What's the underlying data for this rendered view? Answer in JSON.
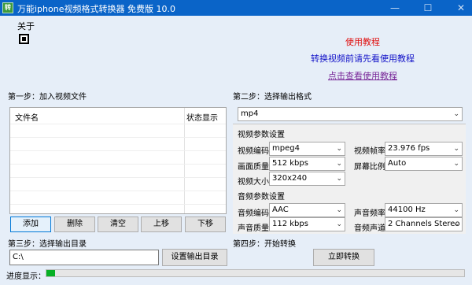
{
  "window": {
    "title": "万能iphone视频格式转换器 免费版 10.0",
    "minimize": "—",
    "maximize": "☐",
    "close": "✕"
  },
  "menu": {
    "about": "关于"
  },
  "help": {
    "tutorial_link": "使用教程",
    "notice": "转换视频前请先看使用教程",
    "view_tutorial_link": "点击查看使用教程"
  },
  "step1": {
    "label": "第一步：加入视频文件",
    "columns": [
      "文件名",
      "状态显示"
    ],
    "buttons": {
      "add": "添加",
      "delete": "删除",
      "clear": "清空",
      "up": "上移",
      "down": "下移"
    }
  },
  "step2": {
    "label": "第二步：选择输出格式",
    "format": "mp4",
    "video": {
      "section": "视频参数设置",
      "codec_label": "视频编码",
      "codec": "mpeg4",
      "framerate_label": "视频帧率",
      "framerate": "23.976 fps",
      "quality_label": "画面质量",
      "quality": "512 kbps",
      "aspect_label": "屏幕比例",
      "aspect": "Auto",
      "size_label": "视频大小",
      "size": "320x240"
    },
    "audio": {
      "section": "音频参数设置",
      "codec_label": "音频编码",
      "codec": "AAC",
      "samplerate_label": "声音频率",
      "samplerate": "44100 Hz",
      "quality_label": "声音质量",
      "quality": "112 kbps",
      "channels_label": "音频声道",
      "channels": "2 Channels Stereo"
    }
  },
  "step3": {
    "label": "第三步：选择输出目录",
    "path": "C:\\",
    "button": "设置输出目录"
  },
  "step4": {
    "label": "第四步：开始转换",
    "button": "立即转换"
  },
  "progress": {
    "label": "进度显示：",
    "value": 0.02
  },
  "colors": {
    "titlebar": "#0a64c8",
    "background": "#e6eef8",
    "link_red": "#e01010",
    "notice_blue": "#1010c8",
    "link_purple": "#7a2a9a",
    "progress": "#06b025"
  },
  "icons": {
    "app": "app-icon",
    "about": "settings-box-icon",
    "dropdown": "chevron-down-icon"
  }
}
